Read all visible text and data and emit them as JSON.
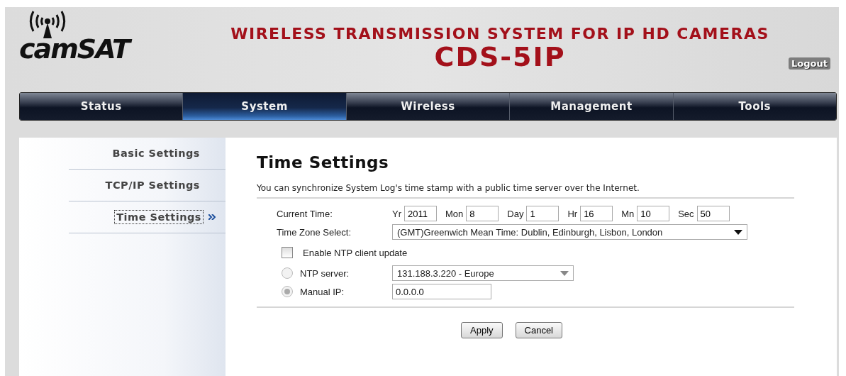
{
  "header": {
    "logo": "camSAT",
    "title": "WIRELESS TRANSMISSION SYSTEM FOR IP HD CAMERAS",
    "model": "CDS-5IP",
    "logout": "Logout"
  },
  "tabs": [
    {
      "label": "Status",
      "selected": false
    },
    {
      "label": "System",
      "selected": true
    },
    {
      "label": "Wireless",
      "selected": false
    },
    {
      "label": "Management",
      "selected": false
    },
    {
      "label": "Tools",
      "selected": false
    }
  ],
  "sidebar": {
    "items": [
      {
        "label": "Basic Settings",
        "selected": false
      },
      {
        "label": "TCP/IP Settings",
        "selected": false
      },
      {
        "label": "Time Settings",
        "selected": true
      }
    ]
  },
  "page": {
    "title": "Time Settings",
    "description": "You can synchronize System Log's time stamp with a public time server over the Internet.",
    "current_time": {
      "label": "Current Time:",
      "fields": [
        {
          "label": "Yr",
          "value": "2011"
        },
        {
          "label": "Mon",
          "value": "8"
        },
        {
          "label": "Day",
          "value": "1"
        },
        {
          "label": "Hr",
          "value": "16"
        },
        {
          "label": "Mn",
          "value": "10"
        },
        {
          "label": "Sec",
          "value": "50"
        }
      ]
    },
    "time_zone": {
      "label": "Time Zone Select:",
      "value": "(GMT)Greenwich Mean Time: Dublin, Edinburgh, Lisbon, London"
    },
    "ntp_enable": {
      "label": "Enable NTP client update",
      "checked": false
    },
    "ntp_server": {
      "label": "NTP server:",
      "selected": false,
      "value": "131.188.3.220 - Europe"
    },
    "manual_ip": {
      "label": "Manual IP:",
      "selected": true,
      "value": "0.0.0.0"
    },
    "buttons": [
      "Apply",
      "Cancel"
    ]
  }
}
